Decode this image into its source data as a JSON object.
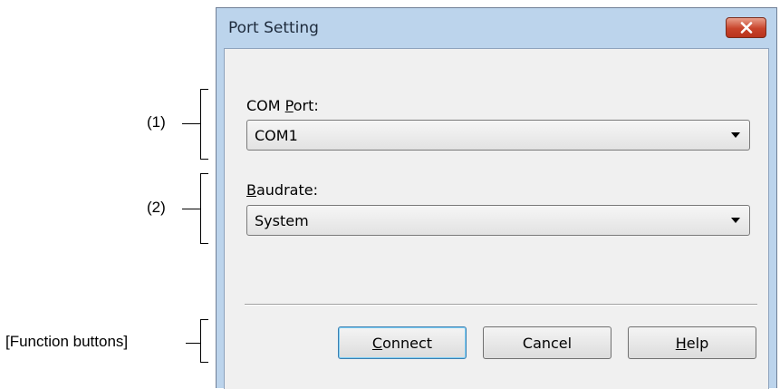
{
  "callouts": {
    "com_port": "(1)",
    "baudrate": "(2)",
    "function_buttons": "[Function buttons]"
  },
  "dialog": {
    "title": "Port Setting",
    "close_icon": "close-x-icon",
    "com_port": {
      "label_accel": "P",
      "label_prefix": "COM ",
      "label_rest": "ort:",
      "value": "COM1"
    },
    "baudrate": {
      "label_accel": "B",
      "label_rest": "audrate:",
      "value": "System"
    },
    "buttons": {
      "connect_accel": "C",
      "connect_rest": "onnect",
      "cancel": "Cancel",
      "help_accel": "H",
      "help_rest": "elp"
    }
  },
  "colors": {
    "frame": "#bcd4ec",
    "client": "#f0f0f0",
    "close_button": "#c8442b"
  }
}
